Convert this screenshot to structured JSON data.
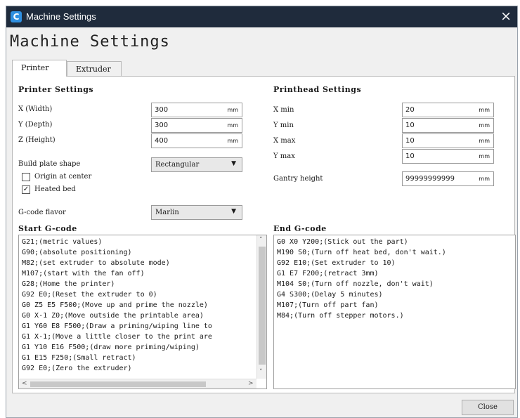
{
  "window": {
    "title": "Machine Settings",
    "close_glyph": "×"
  },
  "page_title": "Machine Settings",
  "tabs": [
    {
      "label": "Printer",
      "active": true
    },
    {
      "label": "Extruder",
      "active": false
    }
  ],
  "printer_settings": {
    "heading": "Printer Settings",
    "fields": [
      {
        "label": "X (Width)",
        "value": "300",
        "unit": "mm"
      },
      {
        "label": "Y (Depth)",
        "value": "300",
        "unit": "mm"
      },
      {
        "label": "Z (Height)",
        "value": "400",
        "unit": "mm"
      }
    ],
    "build_plate": {
      "label": "Build plate shape",
      "value": "Rectangular"
    },
    "origin_at_center": {
      "label": "Origin at center",
      "checked": false
    },
    "heated_bed": {
      "label": "Heated bed",
      "checked": true
    },
    "gcode_flavor": {
      "label": "G-code flavor",
      "value": "Marlin"
    }
  },
  "printhead_settings": {
    "heading": "Printhead Settings",
    "fields": [
      {
        "label": "X min",
        "value": "20",
        "unit": "mm"
      },
      {
        "label": "Y min",
        "value": "10",
        "unit": "mm"
      },
      {
        "label": "X max",
        "value": "10",
        "unit": "mm"
      },
      {
        "label": "Y max",
        "value": "10",
        "unit": "mm"
      }
    ],
    "gantry": {
      "label": "Gantry height",
      "value": "99999999999",
      "unit": "mm"
    }
  },
  "start_gcode": {
    "heading": "Start G-code",
    "lines": [
      "G21;(metric values)",
      "G90;(absolute positioning)",
      "M82;(set extruder to absolute mode)",
      "M107;(start with the fan off)",
      "G28;(Home the printer)",
      "G92 E0;(Reset the extruder to 0)",
      "G0 Z5 E5 F500;(Move up and prime the nozzle)",
      "G0 X-1 Z0;(Move outside the printable area)",
      "G1 Y60 E8 F500;(Draw a priming/wiping line to",
      "G1 X-1;(Move a little closer to the print are",
      "G1 Y10 E16 F500;(draw more priming/wiping)",
      "G1 E15 F250;(Small retract)",
      "G92 E0;(Zero the extruder)"
    ]
  },
  "end_gcode": {
    "heading": "End G-code",
    "lines": [
      "G0 X0 Y200;(Stick out the part)",
      "M190 S0;(Turn off heat bed, don't wait.)",
      "G92 E10;(Set extruder to 10)",
      "G1 E7 F200;(retract 3mm)",
      "M104 S0;(Turn off nozzle, don't wait)",
      "G4 S300;(Delay 5 minutes)",
      "M107;(Turn off part fan)",
      "M84;(Turn off stepper motors.)"
    ]
  },
  "scroll_glyphs": {
    "up": "˄",
    "down": "˅",
    "left": "<",
    "right": ">"
  },
  "dropdown_glyph": "▼",
  "check_glyph": "✓",
  "close_button": "Close",
  "colors": {
    "titlebar": "#1f2b3c",
    "window_bg": "#f0f0f0",
    "icon_accent": "#2f8fe0"
  }
}
